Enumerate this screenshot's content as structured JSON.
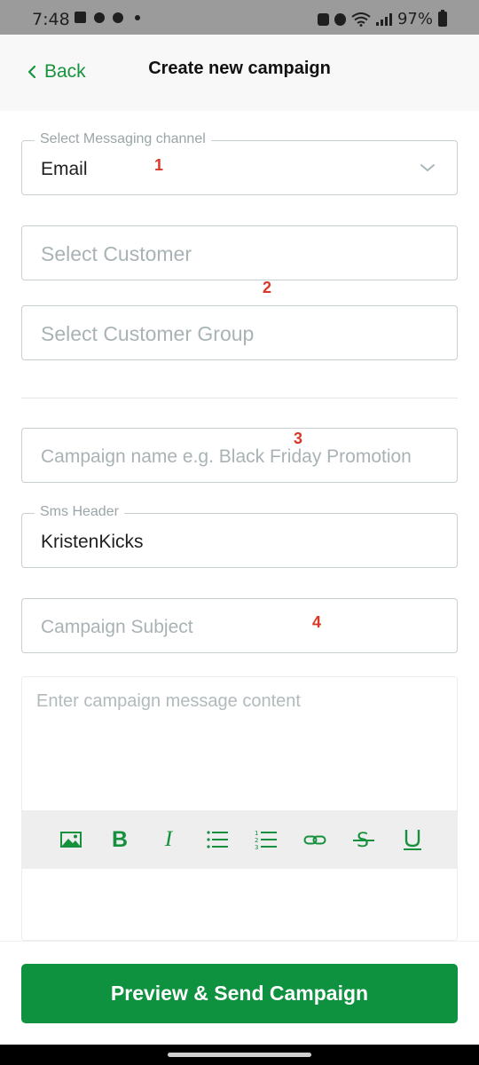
{
  "status_bar": {
    "time": "7:48",
    "battery": "97%"
  },
  "header": {
    "back_label": "Back",
    "title": "Create new campaign"
  },
  "form": {
    "channel": {
      "legend": "Select Messaging channel",
      "value": "Email"
    },
    "customer": {
      "placeholder": "Select Customer"
    },
    "customer_group": {
      "placeholder": "Select Customer Group"
    },
    "campaign_name": {
      "placeholder": "Campaign name e.g. Black Friday Promotion"
    },
    "sms_header": {
      "legend": "Sms Header",
      "value": "KristenKicks"
    },
    "subject": {
      "placeholder": "Campaign Subject"
    },
    "message": {
      "placeholder": "Enter campaign message content"
    }
  },
  "markers": [
    "1",
    "2",
    "3",
    "4"
  ],
  "toolbar": {
    "bold": "B",
    "italic": "I",
    "icons": [
      "image-icon",
      "bold-icon",
      "italic-icon",
      "bullet-list-icon",
      "numbered-list-icon",
      "link-icon",
      "strikethrough-icon",
      "underline-icon"
    ]
  },
  "cta_label": "Preview & Send Campaign",
  "colors": {
    "accent": "#0f9240",
    "marker": "#d8382a"
  }
}
